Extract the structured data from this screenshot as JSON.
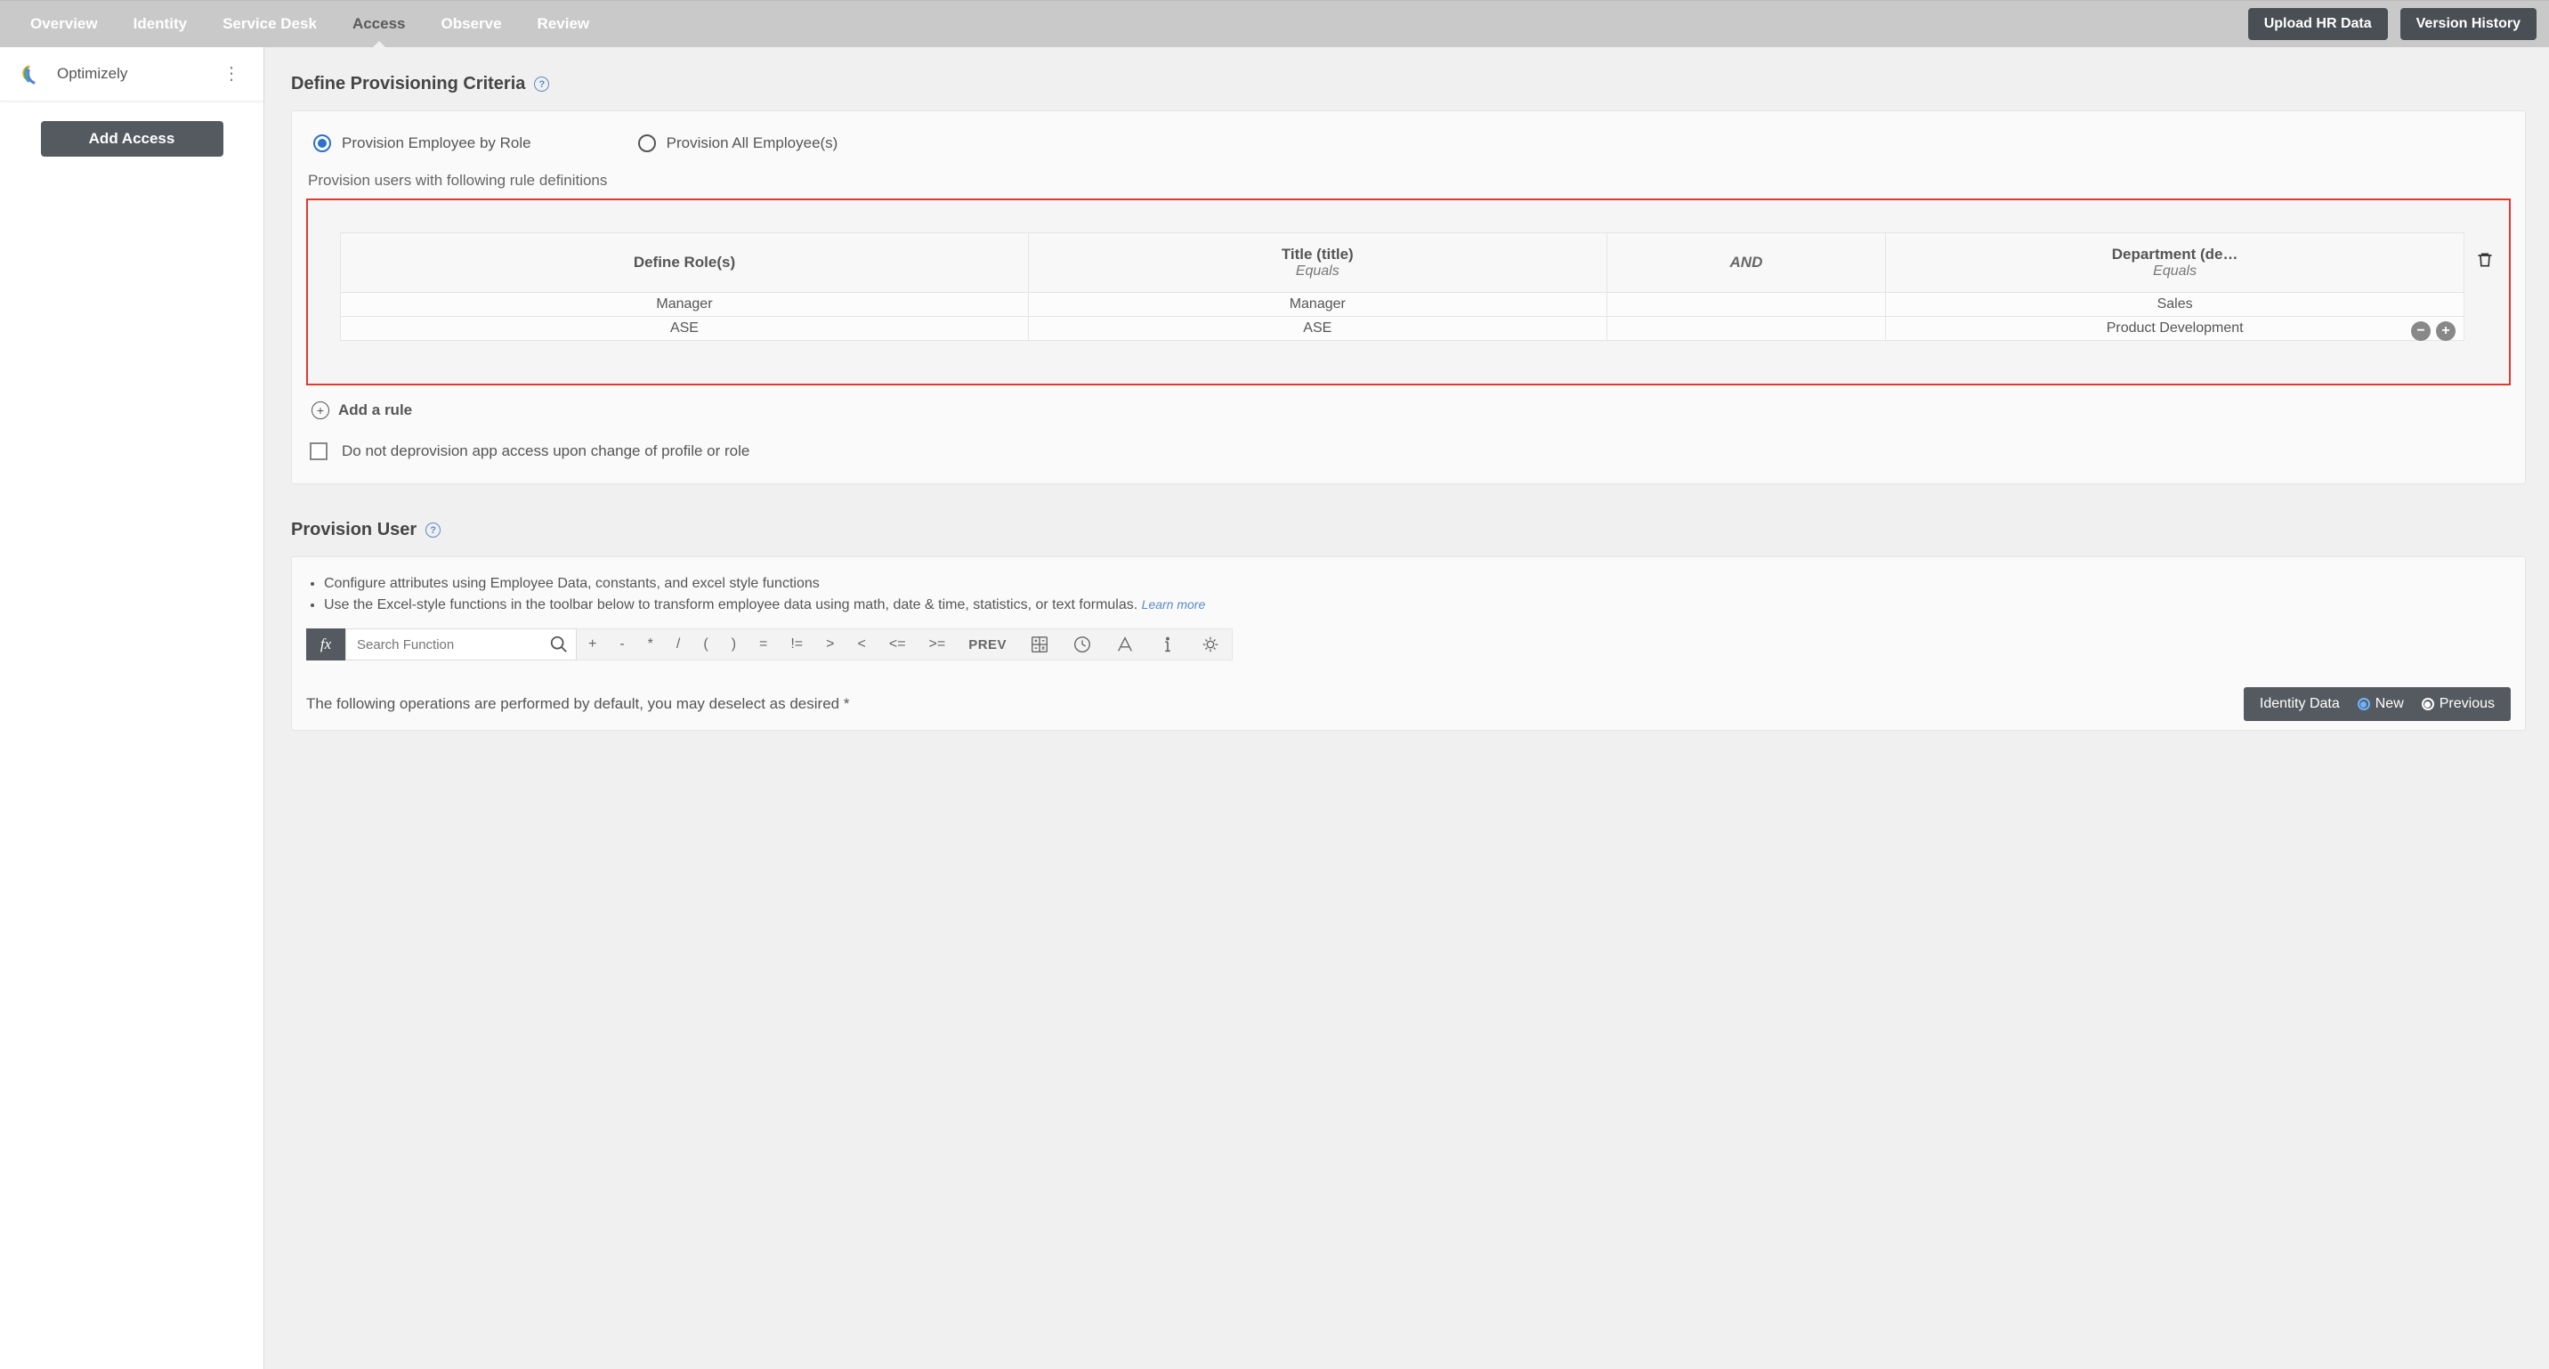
{
  "topbar": {
    "tabs": [
      "Overview",
      "Identity",
      "Service Desk",
      "Access",
      "Observe",
      "Review"
    ],
    "active_tab_index": 3,
    "upload_btn": "Upload HR Data",
    "version_btn": "Version History"
  },
  "sidebar": {
    "app_name": "Optimizely",
    "add_access_btn": "Add Access"
  },
  "criteria": {
    "title": "Define Provisioning Criteria",
    "radio_by_role": "Provision Employee by Role",
    "radio_all": "Provision All Employee(s)",
    "radio_selected": "by_role",
    "rule_sub_label": "Provision users with following rule definitions",
    "table": {
      "headers": {
        "role": "Define Role(s)",
        "title_main": "Title (title)",
        "title_sub": "Equals",
        "and": "AND",
        "dept_main": "Department (de…",
        "dept_sub": "Equals"
      },
      "rows": [
        {
          "role": "Manager",
          "title": "Manager",
          "dept": "Sales"
        },
        {
          "role": "ASE",
          "title": "ASE",
          "dept": "Product Development"
        }
      ]
    },
    "add_rule_label": "Add a rule",
    "checkbox_label": "Do not deprovision app access upon change of profile or role"
  },
  "provision_user": {
    "title": "Provision User",
    "bullets": [
      "Configure attributes using Employee Data, constants, and excel style functions",
      "Use the Excel-style functions in the toolbar below to transform employee data using math, date & time, statistics, or text formulas."
    ],
    "learn_more": "Learn more",
    "fx_label": "fx",
    "search_placeholder": "Search Function",
    "operators": [
      "+",
      "-",
      "*",
      "/",
      "(",
      ")",
      "=",
      "!=",
      ">",
      "<",
      "<=",
      ">="
    ],
    "prev_label": "PREV",
    "footer_text": "The following operations are performed by default, you may deselect as desired *",
    "identity_bar": {
      "label": "Identity Data",
      "opt_new": "New",
      "opt_prev": "Previous",
      "selected": "new"
    }
  }
}
